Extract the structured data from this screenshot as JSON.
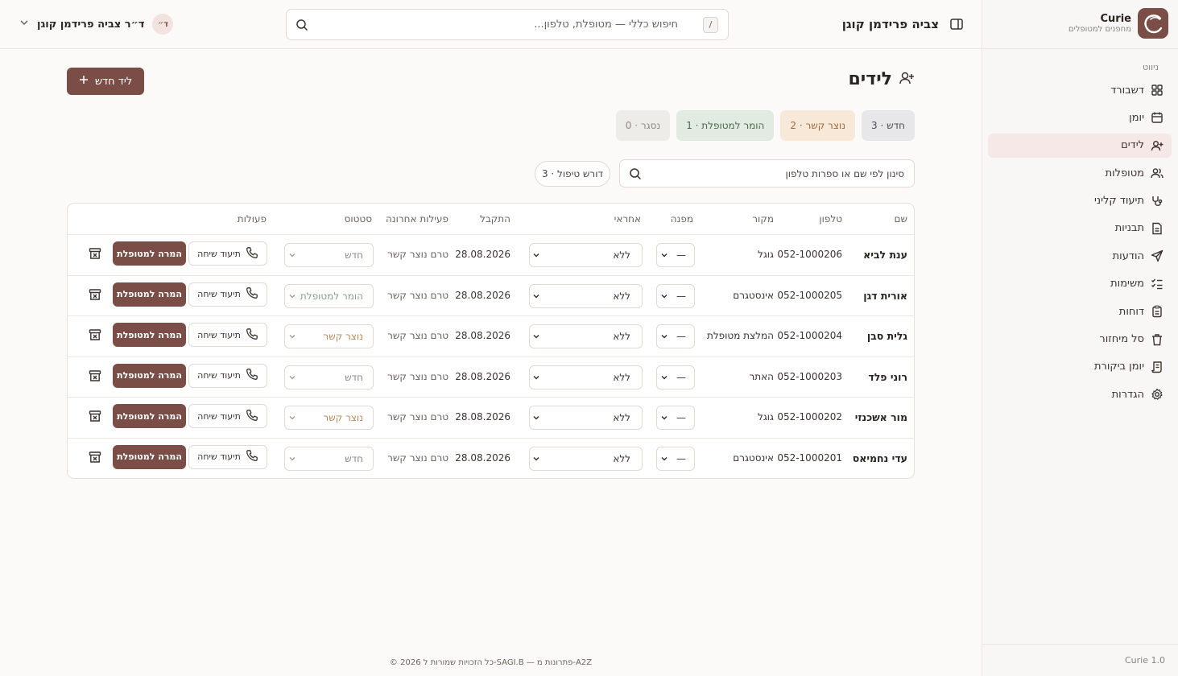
{
  "brand": {
    "name": "Curie",
    "subtitle": "מחפנים למטופלים"
  },
  "sidebar": {
    "heading": "ניווט",
    "items": [
      {
        "label": "דשבורד",
        "icon": "dashboard-icon"
      },
      {
        "label": "יומן",
        "icon": "calendar-icon"
      },
      {
        "label": "לידים",
        "icon": "user-plus-icon",
        "active": true
      },
      {
        "label": "מטופלות",
        "icon": "users-icon"
      },
      {
        "label": "תיעוד קליני",
        "icon": "stethoscope-icon"
      },
      {
        "label": "תבניות",
        "icon": "document-icon"
      },
      {
        "label": "הודעות",
        "icon": "send-icon"
      },
      {
        "label": "משימות",
        "icon": "checklist-icon"
      },
      {
        "label": "דוחות",
        "icon": "clipboard-icon"
      },
      {
        "label": "סל מיחזור",
        "icon": "trash-icon"
      },
      {
        "label": "יומן ביקורת",
        "icon": "scroll-icon"
      },
      {
        "label": "הגדרות",
        "icon": "gear-icon"
      }
    ],
    "version": "Curie 1.0"
  },
  "topbar": {
    "title": "צביה פרידמן קוגן",
    "search_placeholder": "חיפוש כללי — מטופלת, טלפון...",
    "search_shortcut": "/",
    "user_name": "ד״ר צביה פרידמן קוגן",
    "user_initials": "ד״"
  },
  "page": {
    "title": "לידים",
    "new_lead_label": "ליד חדש",
    "filter_placeholder": "סינון לפי שם או ספרות טלפון",
    "needs_care_label": "דורש טיפול · 3"
  },
  "chips": [
    {
      "label": "חדש · 3",
      "kind": "new"
    },
    {
      "label": "נוצר קשר · 2",
      "kind": "contacted"
    },
    {
      "label": "הומר למטופלת · 1",
      "kind": "converted"
    },
    {
      "label": "נסגר · 0",
      "kind": "closed"
    }
  ],
  "table": {
    "headers": {
      "name": "שם",
      "phone": "טלפון",
      "source": "מקור",
      "referrer": "מפנה",
      "owner": "אחראי",
      "received": "התקבל",
      "last_activity": "פעילות אחרונה",
      "status": "סטטוס",
      "actions": "פעולות"
    },
    "call_label": "תיעוד שיחה",
    "convert_label": "המרה למטופלת",
    "rows": [
      {
        "name": "ענת לביא",
        "phone": "052-1000206",
        "source": "גוגל",
        "referrer": "—",
        "owner": "ללא",
        "received": "28.08.2026",
        "last_activity": "טרם נוצר קשר",
        "status": "חדש",
        "status_kind": "new"
      },
      {
        "name": "אורית דגן",
        "phone": "052-1000205",
        "source": "אינסטגרם",
        "referrer": "—",
        "owner": "ללא",
        "received": "28.08.2026",
        "last_activity": "טרם נוצר קשר",
        "status": "הומר למטופלת",
        "status_kind": "converted"
      },
      {
        "name": "גלית סבן",
        "phone": "052-1000204",
        "source": "המלצת מטופלת",
        "referrer": "—",
        "owner": "ללא",
        "received": "28.08.2026",
        "last_activity": "טרם נוצר קשר",
        "status": "נוצר קשר",
        "status_kind": "contacted"
      },
      {
        "name": "רוני פלד",
        "phone": "052-1000203",
        "source": "האתר",
        "referrer": "—",
        "owner": "ללא",
        "received": "28.08.2026",
        "last_activity": "טרם נוצר קשר",
        "status": "חדש",
        "status_kind": "new"
      },
      {
        "name": "מור אשכנזי",
        "phone": "052-1000202",
        "source": "גוגל",
        "referrer": "—",
        "owner": "ללא",
        "received": "28.08.2026",
        "last_activity": "טרם נוצר קשר",
        "status": "נוצר קשר",
        "status_kind": "contacted"
      },
      {
        "name": "עדי נחמיאס",
        "phone": "052-1000201",
        "source": "אינסטגרם",
        "referrer": "—",
        "owner": "ללא",
        "received": "28.08.2026",
        "last_activity": "טרם נוצר קשר",
        "status": "חדש",
        "status_kind": "new"
      }
    ]
  },
  "footer": "© 2026 כל הזכויות שמורות ל-SAGI.B — פתרונות מ-A2Z",
  "colors": {
    "accent": "#7a4e47",
    "active_nav_bg": "#f5e8e6"
  }
}
